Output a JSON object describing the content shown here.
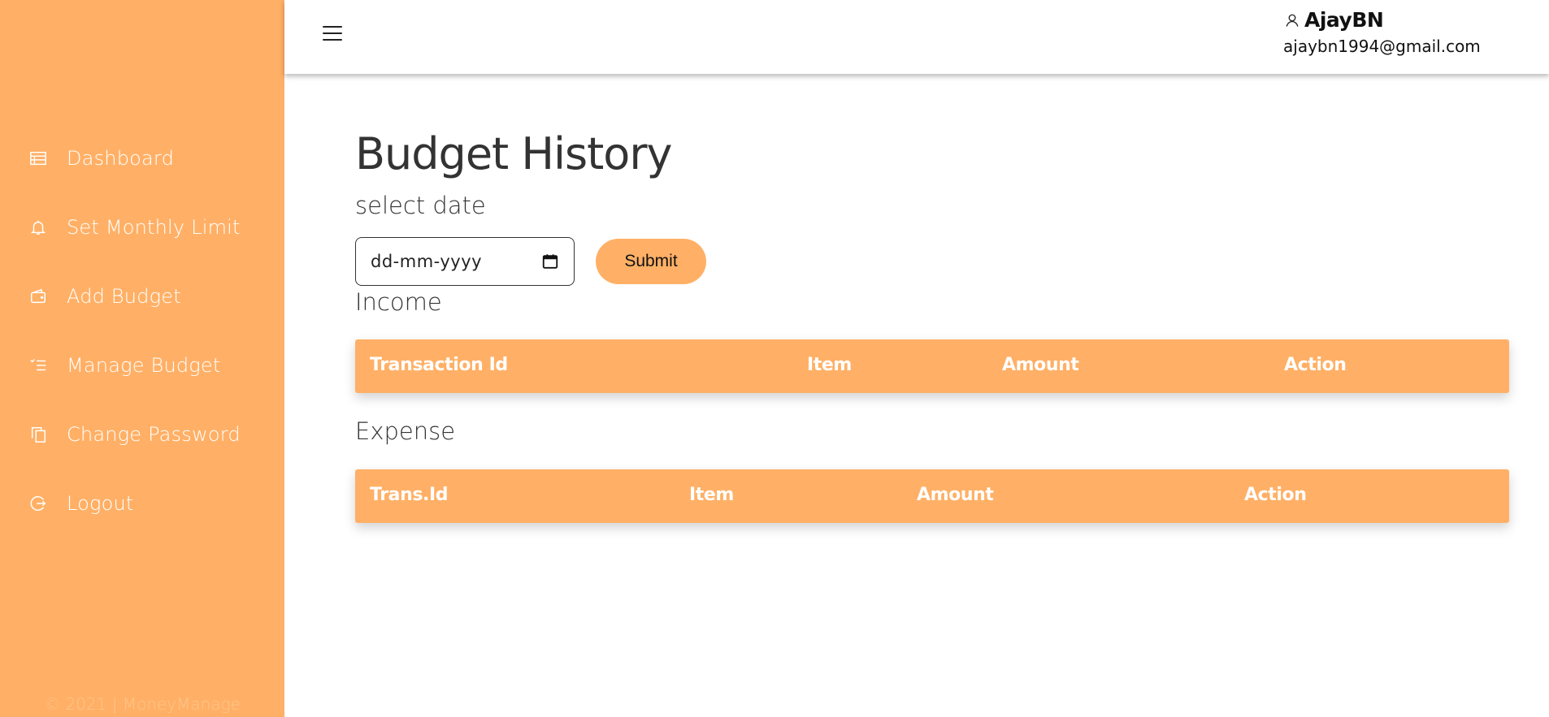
{
  "sidebar": {
    "items": [
      {
        "label": "Dashboard",
        "icon": "dashboard-icon"
      },
      {
        "label": "Set Monthly Limit",
        "icon": "bell-icon"
      },
      {
        "label": "Add Budget",
        "icon": "wallet-icon"
      },
      {
        "label": "Manage Budget",
        "icon": "checklist-icon"
      },
      {
        "label": "Change Password",
        "icon": "copy-icon"
      },
      {
        "label": "Logout",
        "icon": "logout-icon"
      }
    ],
    "footer": "© 2021 | MoneyManage"
  },
  "header": {
    "user_name": "AjayBN",
    "user_email": "ajaybn1994@gmail.com"
  },
  "main": {
    "title": "Budget History",
    "date_label": "select date",
    "date_placeholder": "dd-mm-yyyy",
    "submit_label": "Submit",
    "income": {
      "label": "Income",
      "columns": [
        "Transaction Id",
        "Item",
        "Amount",
        "Action"
      ]
    },
    "expense": {
      "label": "Expense",
      "columns": [
        "Trans.Id",
        "Item",
        "Amount",
        "Action"
      ]
    }
  },
  "colors": {
    "accent": "#ffb066",
    "text": "#333333"
  }
}
